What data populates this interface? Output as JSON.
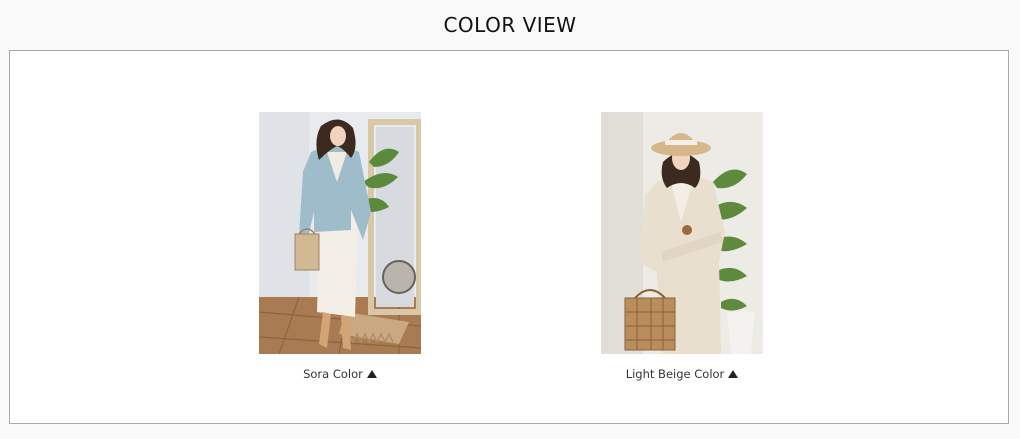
{
  "section": {
    "title": "COLOR VIEW"
  },
  "items": [
    {
      "caption": "Sora Color",
      "icon": "triangle-up-icon",
      "jacket_color": "#9fbccb"
    },
    {
      "caption": "Light Beige Color",
      "icon": "triangle-up-icon",
      "jacket_color": "#e9dfcf"
    }
  ]
}
